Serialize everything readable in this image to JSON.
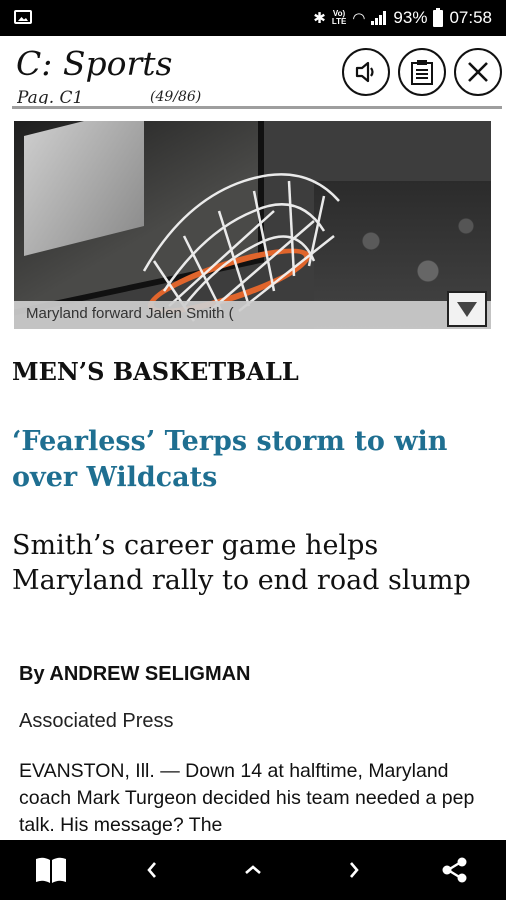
{
  "status_bar": {
    "battery": "93%",
    "time": "07:58",
    "network_label": "Vo) LTE"
  },
  "header": {
    "section_title": "C: Sports",
    "page_label": "Pag. C1",
    "page_counter": "(49/86)"
  },
  "photo": {
    "caption": "Maryland forward Jalen Smith ("
  },
  "article": {
    "kicker": "MEN’S BASKETBALL",
    "headline": "‘Fearless’ Terps storm to win over Wildcats",
    "subhead": "Smith’s career game helps Maryland rally to end road slump",
    "byline": "By ANDREW SELIGMAN",
    "agency": "Associated Press",
    "body": "EVANSTON, Ill. — Down 14 at halftime, Maryland coach Mark Turgeon decided his team needed a pep talk. His message? The"
  },
  "icons": {
    "audio": "speaker-icon",
    "text_view": "document-icon",
    "close": "close-icon",
    "caption_expand": "triangle-down-icon",
    "library": "open-book-icon",
    "prev": "chevron-left-icon",
    "up": "chevron-up-icon",
    "next": "chevron-right-icon",
    "share": "share-icon"
  }
}
